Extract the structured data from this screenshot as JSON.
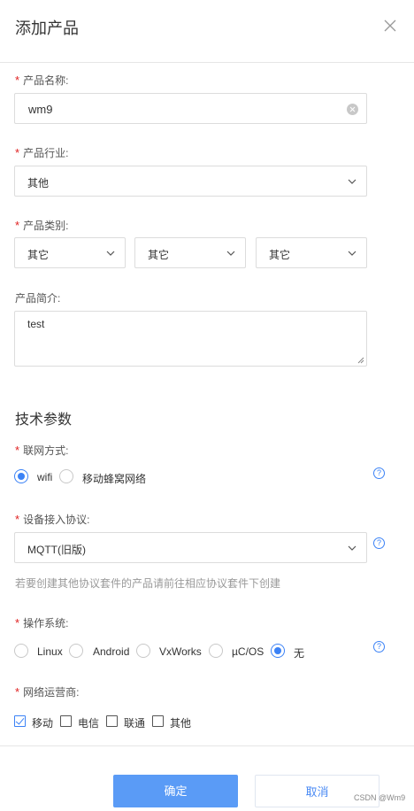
{
  "dialog": {
    "title": "添加产品"
  },
  "product_name": {
    "label": "产品名称:",
    "value": "wm9"
  },
  "industry": {
    "label": "产品行业:",
    "value": "其他"
  },
  "category": {
    "label": "产品类别:",
    "values": [
      "其它",
      "其它",
      "其它"
    ]
  },
  "description": {
    "label": "产品简介:",
    "value": "test"
  },
  "tech": {
    "section_title": "技术参数"
  },
  "network": {
    "label": "联网方式:",
    "options": [
      "wifi",
      "移动蜂窝网络"
    ],
    "selected": "wifi"
  },
  "protocol": {
    "label": "设备接入协议:",
    "value": "MQTT(旧版)",
    "hint": "若要创建其他协议套件的产品请前往相应协议套件下创建"
  },
  "os": {
    "label": "操作系统:",
    "options": [
      "Linux",
      "Android",
      "VxWorks",
      "µC/OS",
      "无"
    ],
    "selected": "无"
  },
  "carrier": {
    "label": "网络运营商:",
    "options": [
      "移动",
      "电信",
      "联通",
      "其他"
    ],
    "checked": [
      "移动"
    ]
  },
  "footer": {
    "confirm": "确定",
    "cancel": "取消"
  },
  "watermark": "CSDN @Wm9",
  "help_glyph": "?",
  "colors": {
    "accent": "#3b82f6",
    "required": "#e02020",
    "primary_button": "#5a9bf6"
  }
}
